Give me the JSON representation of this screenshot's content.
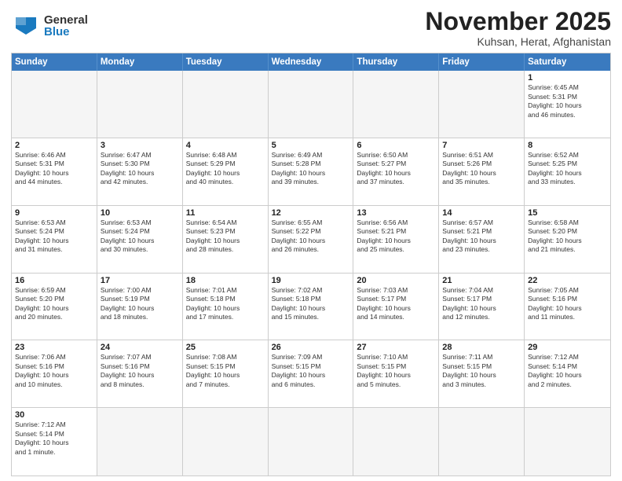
{
  "header": {
    "logo_general": "General",
    "logo_blue": "Blue",
    "title": "November 2025",
    "subtitle": "Kuhsan, Herat, Afghanistan"
  },
  "days_of_week": [
    "Sunday",
    "Monday",
    "Tuesday",
    "Wednesday",
    "Thursday",
    "Friday",
    "Saturday"
  ],
  "weeks": [
    [
      {
        "num": "",
        "info": "",
        "empty": true
      },
      {
        "num": "",
        "info": "",
        "empty": true
      },
      {
        "num": "",
        "info": "",
        "empty": true
      },
      {
        "num": "",
        "info": "",
        "empty": true
      },
      {
        "num": "",
        "info": "",
        "empty": true
      },
      {
        "num": "",
        "info": "",
        "empty": true
      },
      {
        "num": "1",
        "info": "Sunrise: 6:45 AM\nSunset: 5:31 PM\nDaylight: 10 hours\nand 46 minutes."
      }
    ],
    [
      {
        "num": "2",
        "info": "Sunrise: 6:46 AM\nSunset: 5:31 PM\nDaylight: 10 hours\nand 44 minutes."
      },
      {
        "num": "3",
        "info": "Sunrise: 6:47 AM\nSunset: 5:30 PM\nDaylight: 10 hours\nand 42 minutes."
      },
      {
        "num": "4",
        "info": "Sunrise: 6:48 AM\nSunset: 5:29 PM\nDaylight: 10 hours\nand 40 minutes."
      },
      {
        "num": "5",
        "info": "Sunrise: 6:49 AM\nSunset: 5:28 PM\nDaylight: 10 hours\nand 39 minutes."
      },
      {
        "num": "6",
        "info": "Sunrise: 6:50 AM\nSunset: 5:27 PM\nDaylight: 10 hours\nand 37 minutes."
      },
      {
        "num": "7",
        "info": "Sunrise: 6:51 AM\nSunset: 5:26 PM\nDaylight: 10 hours\nand 35 minutes."
      },
      {
        "num": "8",
        "info": "Sunrise: 6:52 AM\nSunset: 5:25 PM\nDaylight: 10 hours\nand 33 minutes."
      }
    ],
    [
      {
        "num": "9",
        "info": "Sunrise: 6:53 AM\nSunset: 5:24 PM\nDaylight: 10 hours\nand 31 minutes."
      },
      {
        "num": "10",
        "info": "Sunrise: 6:53 AM\nSunset: 5:24 PM\nDaylight: 10 hours\nand 30 minutes."
      },
      {
        "num": "11",
        "info": "Sunrise: 6:54 AM\nSunset: 5:23 PM\nDaylight: 10 hours\nand 28 minutes."
      },
      {
        "num": "12",
        "info": "Sunrise: 6:55 AM\nSunset: 5:22 PM\nDaylight: 10 hours\nand 26 minutes."
      },
      {
        "num": "13",
        "info": "Sunrise: 6:56 AM\nSunset: 5:21 PM\nDaylight: 10 hours\nand 25 minutes."
      },
      {
        "num": "14",
        "info": "Sunrise: 6:57 AM\nSunset: 5:21 PM\nDaylight: 10 hours\nand 23 minutes."
      },
      {
        "num": "15",
        "info": "Sunrise: 6:58 AM\nSunset: 5:20 PM\nDaylight: 10 hours\nand 21 minutes."
      }
    ],
    [
      {
        "num": "16",
        "info": "Sunrise: 6:59 AM\nSunset: 5:20 PM\nDaylight: 10 hours\nand 20 minutes."
      },
      {
        "num": "17",
        "info": "Sunrise: 7:00 AM\nSunset: 5:19 PM\nDaylight: 10 hours\nand 18 minutes."
      },
      {
        "num": "18",
        "info": "Sunrise: 7:01 AM\nSunset: 5:18 PM\nDaylight: 10 hours\nand 17 minutes."
      },
      {
        "num": "19",
        "info": "Sunrise: 7:02 AM\nSunset: 5:18 PM\nDaylight: 10 hours\nand 15 minutes."
      },
      {
        "num": "20",
        "info": "Sunrise: 7:03 AM\nSunset: 5:17 PM\nDaylight: 10 hours\nand 14 minutes."
      },
      {
        "num": "21",
        "info": "Sunrise: 7:04 AM\nSunset: 5:17 PM\nDaylight: 10 hours\nand 12 minutes."
      },
      {
        "num": "22",
        "info": "Sunrise: 7:05 AM\nSunset: 5:16 PM\nDaylight: 10 hours\nand 11 minutes."
      }
    ],
    [
      {
        "num": "23",
        "info": "Sunrise: 7:06 AM\nSunset: 5:16 PM\nDaylight: 10 hours\nand 10 minutes."
      },
      {
        "num": "24",
        "info": "Sunrise: 7:07 AM\nSunset: 5:16 PM\nDaylight: 10 hours\nand 8 minutes."
      },
      {
        "num": "25",
        "info": "Sunrise: 7:08 AM\nSunset: 5:15 PM\nDaylight: 10 hours\nand 7 minutes."
      },
      {
        "num": "26",
        "info": "Sunrise: 7:09 AM\nSunset: 5:15 PM\nDaylight: 10 hours\nand 6 minutes."
      },
      {
        "num": "27",
        "info": "Sunrise: 7:10 AM\nSunset: 5:15 PM\nDaylight: 10 hours\nand 5 minutes."
      },
      {
        "num": "28",
        "info": "Sunrise: 7:11 AM\nSunset: 5:15 PM\nDaylight: 10 hours\nand 3 minutes."
      },
      {
        "num": "29",
        "info": "Sunrise: 7:12 AM\nSunset: 5:14 PM\nDaylight: 10 hours\nand 2 minutes."
      }
    ],
    [
      {
        "num": "30",
        "info": "Sunrise: 7:12 AM\nSunset: 5:14 PM\nDaylight: 10 hours\nand 1 minute."
      },
      {
        "num": "",
        "info": "",
        "empty": true
      },
      {
        "num": "",
        "info": "",
        "empty": true
      },
      {
        "num": "",
        "info": "",
        "empty": true
      },
      {
        "num": "",
        "info": "",
        "empty": true
      },
      {
        "num": "",
        "info": "",
        "empty": true
      },
      {
        "num": "",
        "info": "",
        "empty": true
      }
    ]
  ]
}
